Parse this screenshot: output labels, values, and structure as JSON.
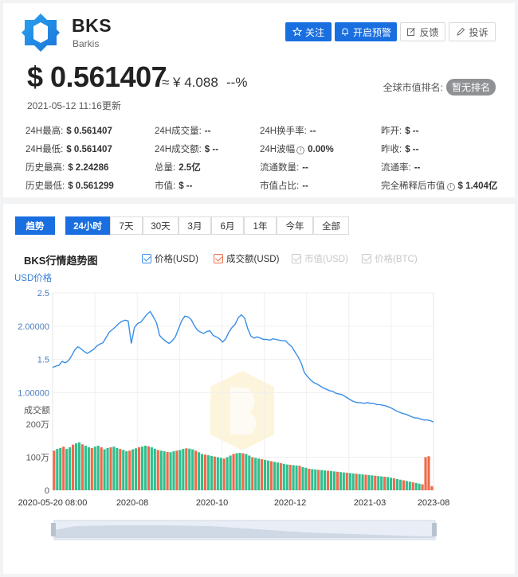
{
  "coin": {
    "symbol": "BKS",
    "name": "Barkis"
  },
  "buttons": {
    "follow": "关注",
    "alert": "开启预警",
    "feedback": "反馈",
    "complain": "投诉"
  },
  "price": {
    "usd": "$ 0.561407",
    "cny": "≈ ¥ 4.088",
    "change": "--%",
    "updated": "2021-05-12 11:16更新"
  },
  "rank": {
    "label": "全球市值排名:",
    "value": "暂无排名"
  },
  "stats": [
    {
      "label": "24H最高:",
      "value": "$ 0.561407"
    },
    {
      "label": "24H成交量:",
      "value": "--"
    },
    {
      "label": "24H换手率:",
      "value": "--"
    },
    {
      "label": "昨开:",
      "value": "$ --"
    },
    {
      "label": "24H最低:",
      "value": "$ 0.561407"
    },
    {
      "label": "24H成交额:",
      "value": "$ --"
    },
    {
      "label": "24H波幅",
      "value": "0.00%"
    },
    {
      "label": "昨收:",
      "value": "$ --"
    },
    {
      "label": "历史最高:",
      "value": "$ 2.24286"
    },
    {
      "label": "总量:",
      "value": "2.5亿"
    },
    {
      "label": "流通数量:",
      "value": "--"
    },
    {
      "label": "流通率:",
      "value": "--"
    },
    {
      "label": "历史最低:",
      "value": "$ 0.561299"
    },
    {
      "label": "市值:",
      "value": "$ --"
    },
    {
      "label": "市值占比:",
      "value": "--"
    },
    {
      "label": "完全稀释后市值",
      "value": "$ 1.404亿"
    }
  ],
  "tabs": {
    "trend": "趋势",
    "ranges": [
      "24小时",
      "7天",
      "30天",
      "3月",
      "6月",
      "1年",
      "今年",
      "全部"
    ],
    "active": 0
  },
  "legend": [
    {
      "label": "价格(USD)",
      "color": "#3a8ee6",
      "enabled": true
    },
    {
      "label": "成交额(USD)",
      "color": "#f06a4a",
      "enabled": true
    },
    {
      "label": "市值(USD)",
      "color": "#c8c8c8",
      "enabled": false
    },
    {
      "label": "价格(BTC)",
      "color": "#c8c8c8",
      "enabled": false
    }
  ],
  "colors": {
    "accent": "#1a6fe0",
    "price_line": "#3a8ee6",
    "vol_up": "#2fbf8f",
    "vol_down": "#f06a4a"
  },
  "chart_data": {
    "type": "line",
    "title": "BKS行情趋势图",
    "ylabel": "USD价格",
    "ylabel2": "成交额",
    "ylim": [
      0,
      2.5
    ],
    "yticks": [
      "2.5",
      "2.00000",
      "1.5",
      "1.00000"
    ],
    "vol_ylim": [
      0,
      2000000
    ],
    "vol_yticks": [
      "200万",
      "100万",
      "0"
    ],
    "xticks": [
      "2020-05-20 08:00",
      "2020-08",
      "2020-10",
      "2020-12",
      "2021-03",
      "2023-08"
    ],
    "series": [
      {
        "name": "价格(USD)",
        "values": [
          1.38,
          1.4,
          1.41,
          1.47,
          1.45,
          1.48,
          1.55,
          1.64,
          1.69,
          1.66,
          1.62,
          1.59,
          1.62,
          1.65,
          1.7,
          1.73,
          1.75,
          1.83,
          1.91,
          1.95,
          1.99,
          2.04,
          2.07,
          2.09,
          2.08,
          1.74,
          1.98,
          2.04,
          2.06,
          2.12,
          2.18,
          2.22,
          2.14,
          2.05,
          1.86,
          1.81,
          1.77,
          1.74,
          1.78,
          1.84,
          1.96,
          2.08,
          2.15,
          2.14,
          2.1,
          2.01,
          1.94,
          1.91,
          1.89,
          1.92,
          1.93,
          1.86,
          1.84,
          1.81,
          1.76,
          1.81,
          1.91,
          1.98,
          2.03,
          2.13,
          2.17,
          2.12,
          1.96,
          1.85,
          1.82,
          1.84,
          1.82,
          1.8,
          1.8,
          1.79,
          1.81,
          1.8,
          1.79,
          1.78,
          1.78,
          1.73,
          1.69,
          1.61,
          1.54,
          1.44,
          1.3,
          1.24,
          1.19,
          1.15,
          1.13,
          1.1,
          1.07,
          1.05,
          1.03,
          1.02,
          0.99,
          0.98,
          0.97,
          0.94,
          0.91,
          0.88,
          0.86,
          0.85,
          0.85,
          0.84,
          0.85,
          0.84,
          0.84,
          0.82,
          0.82,
          0.81,
          0.8,
          0.78,
          0.76,
          0.73,
          0.71,
          0.69,
          0.68,
          0.66,
          0.64,
          0.62,
          0.62,
          0.6,
          0.59,
          0.59,
          0.58,
          0.56
        ]
      },
      {
        "name": "成交额(USD)",
        "values": [
          1200000,
          1250000,
          1280000,
          1320000,
          1250000,
          1300000,
          1380000,
          1420000,
          1450000,
          1390000,
          1350000,
          1300000,
          1280000,
          1320000,
          1350000,
          1300000,
          1240000,
          1280000,
          1300000,
          1320000,
          1280000,
          1250000,
          1220000,
          1180000,
          1200000,
          1240000,
          1270000,
          1300000,
          1320000,
          1350000,
          1330000,
          1300000,
          1260000,
          1220000,
          1200000,
          1180000,
          1160000,
          1150000,
          1180000,
          1200000,
          1220000,
          1250000,
          1270000,
          1260000,
          1240000,
          1200000,
          1150000,
          1100000,
          1080000,
          1060000,
          1040000,
          1020000,
          1000000,
          980000,
          960000,
          1000000,
          1050000,
          1100000,
          1120000,
          1130000,
          1120000,
          1100000,
          1050000,
          1000000,
          980000,
          960000,
          940000,
          920000,
          900000,
          880000,
          860000,
          840000,
          820000,
          800000,
          780000,
          770000,
          760000,
          750000,
          740000,
          700000,
          680000,
          650000,
          640000,
          630000,
          620000,
          610000,
          600000,
          590000,
          580000,
          570000,
          560000,
          550000,
          540000,
          530000,
          520000,
          510000,
          500000,
          490000,
          480000,
          470000,
          460000,
          450000,
          440000,
          430000,
          420000,
          410000,
          400000,
          380000,
          360000,
          340000,
          320000,
          300000,
          280000,
          260000,
          240000,
          220000,
          200000,
          180000,
          1000000,
          1030000,
          120000
        ]
      }
    ]
  }
}
